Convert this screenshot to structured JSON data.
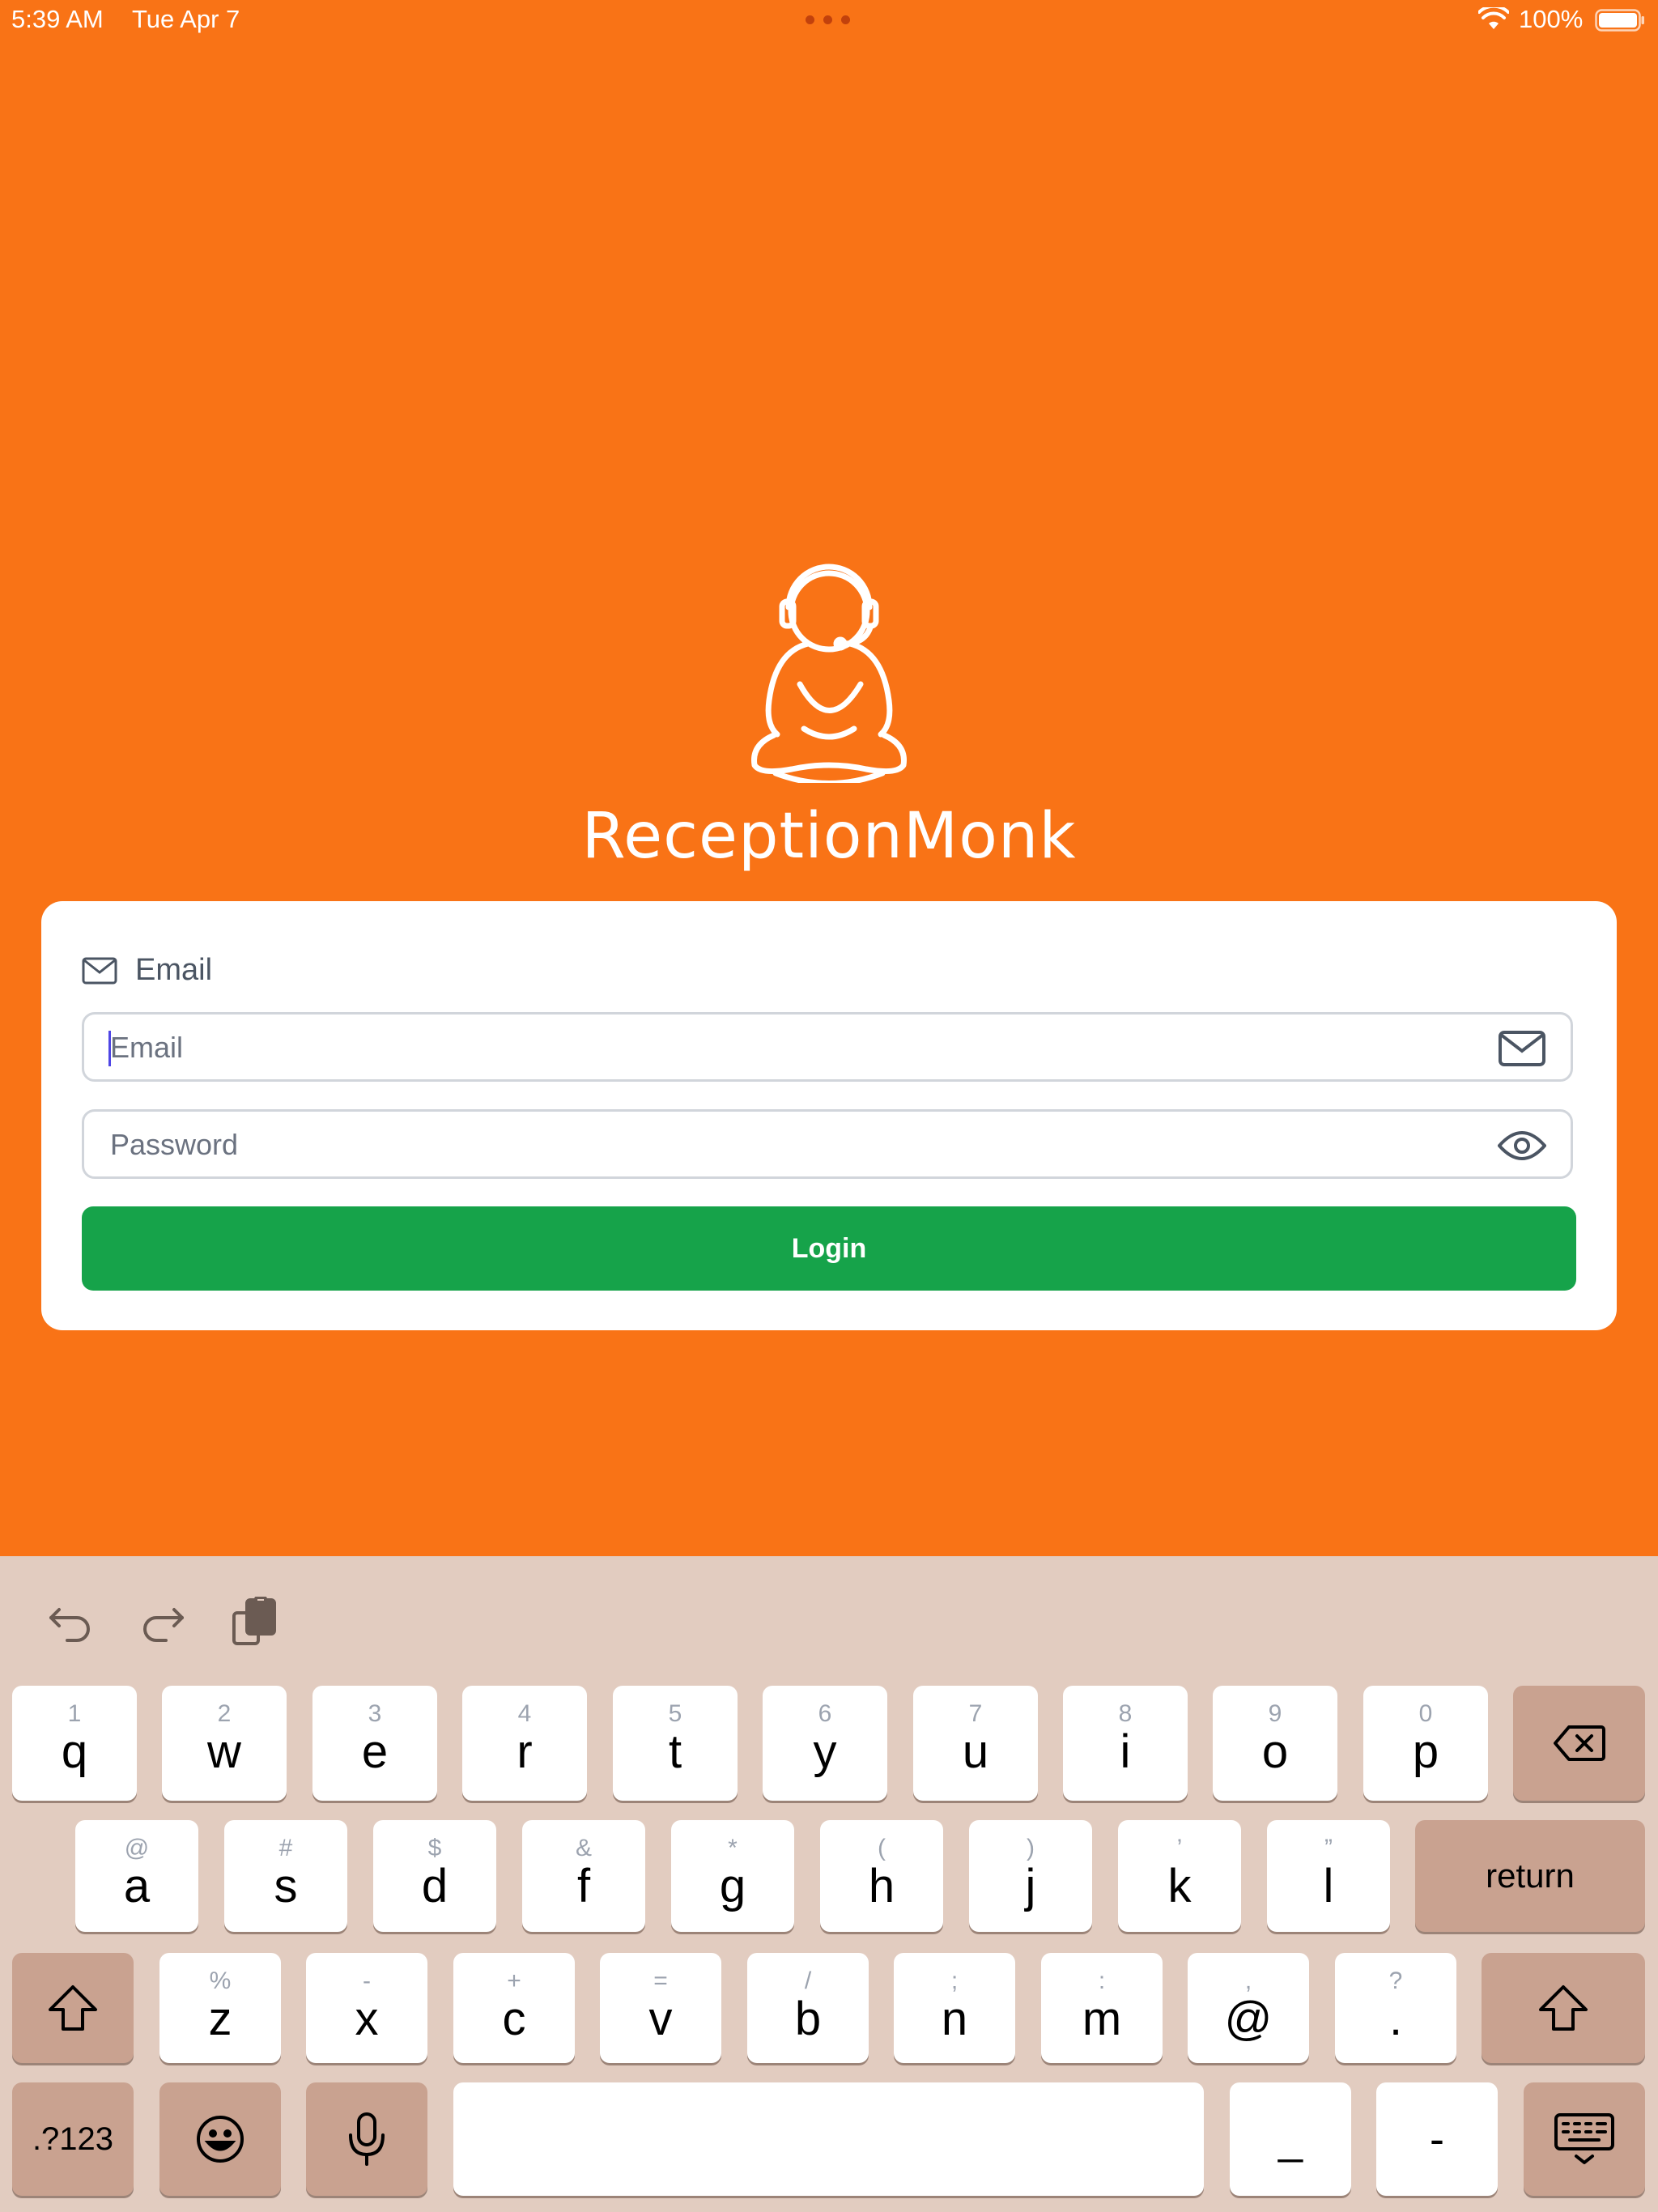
{
  "status_bar": {
    "time": "5:39 AM",
    "date": "Tue Apr 7",
    "battery_percent": "100%"
  },
  "app": {
    "name": "ReceptionMonk"
  },
  "login_card": {
    "tab_label": "Email",
    "email_placeholder": "Email",
    "password_placeholder": "Password",
    "login_label": "Login"
  },
  "colors": {
    "background": "#F97316",
    "login_button": "#16A34A",
    "keyboard": "#E2CCC0"
  },
  "keyboard": {
    "row1": [
      {
        "hint": "1",
        "char": "q"
      },
      {
        "hint": "2",
        "char": "w"
      },
      {
        "hint": "3",
        "char": "e"
      },
      {
        "hint": "4",
        "char": "r"
      },
      {
        "hint": "5",
        "char": "t"
      },
      {
        "hint": "6",
        "char": "y"
      },
      {
        "hint": "7",
        "char": "u"
      },
      {
        "hint": "8",
        "char": "i"
      },
      {
        "hint": "9",
        "char": "o"
      },
      {
        "hint": "0",
        "char": "p"
      }
    ],
    "row2": [
      {
        "hint": "@",
        "char": "a"
      },
      {
        "hint": "#",
        "char": "s"
      },
      {
        "hint": "$",
        "char": "d"
      },
      {
        "hint": "&",
        "char": "f"
      },
      {
        "hint": "*",
        "char": "g"
      },
      {
        "hint": "(",
        "char": "h"
      },
      {
        "hint": ")",
        "char": "j"
      },
      {
        "hint": "’",
        "char": "k"
      },
      {
        "hint": "”",
        "char": "l"
      }
    ],
    "row3": [
      {
        "hint": "%",
        "char": "z"
      },
      {
        "hint": "-",
        "char": "x"
      },
      {
        "hint": "+",
        "char": "c"
      },
      {
        "hint": "=",
        "char": "v"
      },
      {
        "hint": "/",
        "char": "b"
      },
      {
        "hint": ";",
        "char": "n"
      },
      {
        "hint": ":",
        "char": "m"
      },
      {
        "hint": ",",
        "char": "@"
      },
      {
        "hint": "?",
        "char": "."
      }
    ],
    "return_label": "return",
    "numbers_label": ".?123",
    "underscore_label": "_",
    "dash_label": "-",
    "icons": [
      "undo-icon",
      "redo-icon",
      "clipboard-icon",
      "backspace-icon",
      "shift-icon",
      "emoji-icon",
      "microphone-icon",
      "keyboard-dismiss-icon"
    ]
  }
}
